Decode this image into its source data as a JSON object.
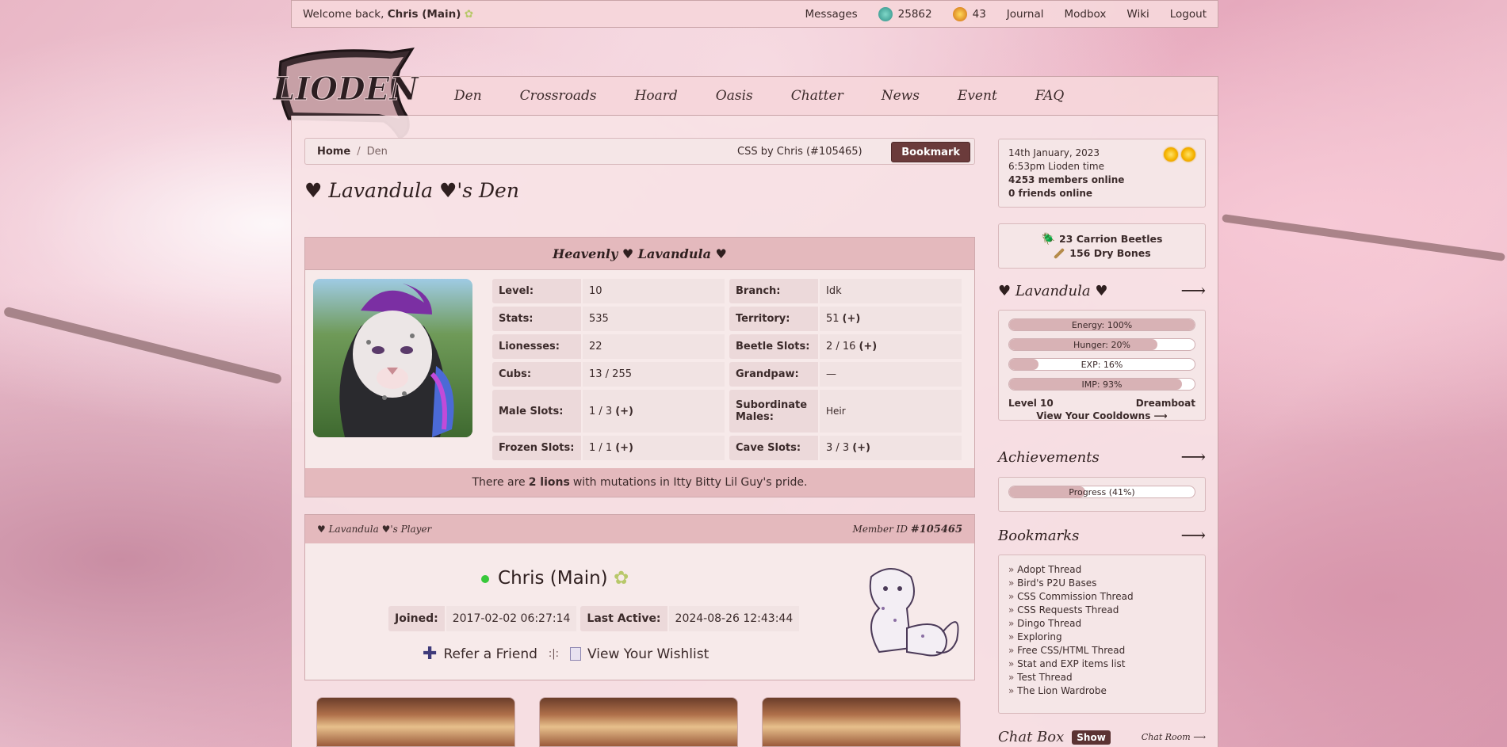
{
  "topbar": {
    "welcome_prefix": "Welcome back,",
    "user": "Chris (Main)",
    "messages": "Messages",
    "beetles": "25862",
    "bones": "43",
    "journal": "Journal",
    "modbox": "Modbox",
    "wiki": "Wiki",
    "logout": "Logout"
  },
  "nav": [
    "Den",
    "Crossroads",
    "Hoard",
    "Oasis",
    "Chatter",
    "News",
    "Event",
    "FAQ"
  ],
  "breadcrumb": {
    "home": "Home",
    "sep": "/",
    "current": "Den",
    "css_by": "CSS by Chris (#105465)",
    "bookmark": "Bookmark"
  },
  "den_title": "♥ Lavandula ♥'s Den",
  "den_panel": {
    "name": "Heavenly ♥ Lavandula ♥",
    "stats": [
      {
        "k": "Level:",
        "v": "10"
      },
      {
        "k": "Branch:",
        "v": "Idk"
      },
      {
        "k": "Stats:",
        "v": "535"
      },
      {
        "k": "Territory:",
        "v": "51",
        "plus": "(+)"
      },
      {
        "k": "Lionesses:",
        "v": "22"
      },
      {
        "k": "Beetle Slots:",
        "v": "2 / 16",
        "plus": "(+)"
      },
      {
        "k": "Cubs:",
        "v": "13 / 255"
      },
      {
        "k": "Grandpaw:",
        "v": "—"
      },
      {
        "k": "Male Slots:",
        "v": "1 / 3",
        "plus": "(+)"
      },
      {
        "k": "Subordinate Males:",
        "v": "Heir"
      },
      {
        "k": "Frozen Slots:",
        "v": "1 / 1",
        "plus": "(+)"
      },
      {
        "k": "Cave Slots:",
        "v": "3 / 3",
        "plus": "(+)"
      }
    ],
    "mutation_pre": "There are",
    "mutation_count": "2 lions",
    "mutation_post": "with mutations in Itty Bitty Lil Guy's pride."
  },
  "player": {
    "header_left": "♥ Lavandula ♥'s Player",
    "member_label": "Member ID",
    "member_id": "#105465",
    "name": "Chris (Main)",
    "joined_label": "Joined:",
    "joined": "2017-02-02 06:27:14",
    "active_label": "Last Active:",
    "active": "2024-08-26 12:43:44",
    "refer": "Refer a Friend",
    "sep": ":|:",
    "wishlist": "View Your Wishlist"
  },
  "sidebar": {
    "date": "14th January, 2023",
    "time": "6:53pm Lioden time",
    "members_online": "4253 members online",
    "friends_online": "0 friends online",
    "carrion": "23 Carrion Beetles",
    "bones": "156 Dry Bones",
    "lion_title": "♥ Lavandula ♥",
    "bars": [
      {
        "label": "Energy: 100%",
        "value": 1.0
      },
      {
        "label": "Hunger: 20%",
        "value": 0.8
      },
      {
        "label": "EXP: 16%",
        "value": 0.16
      },
      {
        "label": "IMP: 93%",
        "value": 0.93
      }
    ],
    "level": "Level 10",
    "mood": "Dreamboat",
    "cooldowns": "View Your Cooldowns ⟶",
    "achievements_title": "Achievements",
    "achievements_progress": "Progress (41%)",
    "achievements_value": 0.41,
    "bookmarks_title": "Bookmarks",
    "bookmarks": [
      "Adopt Thread",
      "Bird's P2U Bases",
      "CSS Commission Thread",
      "CSS Requests Thread",
      "Dingo Thread",
      "Exploring",
      "Free CSS/HTML Thread",
      "Stat and EXP items list",
      "Test Thread",
      "The Lion Wardrobe"
    ],
    "chat_title": "Chat Box",
    "chat_show": "Show",
    "chat_room": "Chat Room ⟶"
  },
  "arrow": "⟶"
}
